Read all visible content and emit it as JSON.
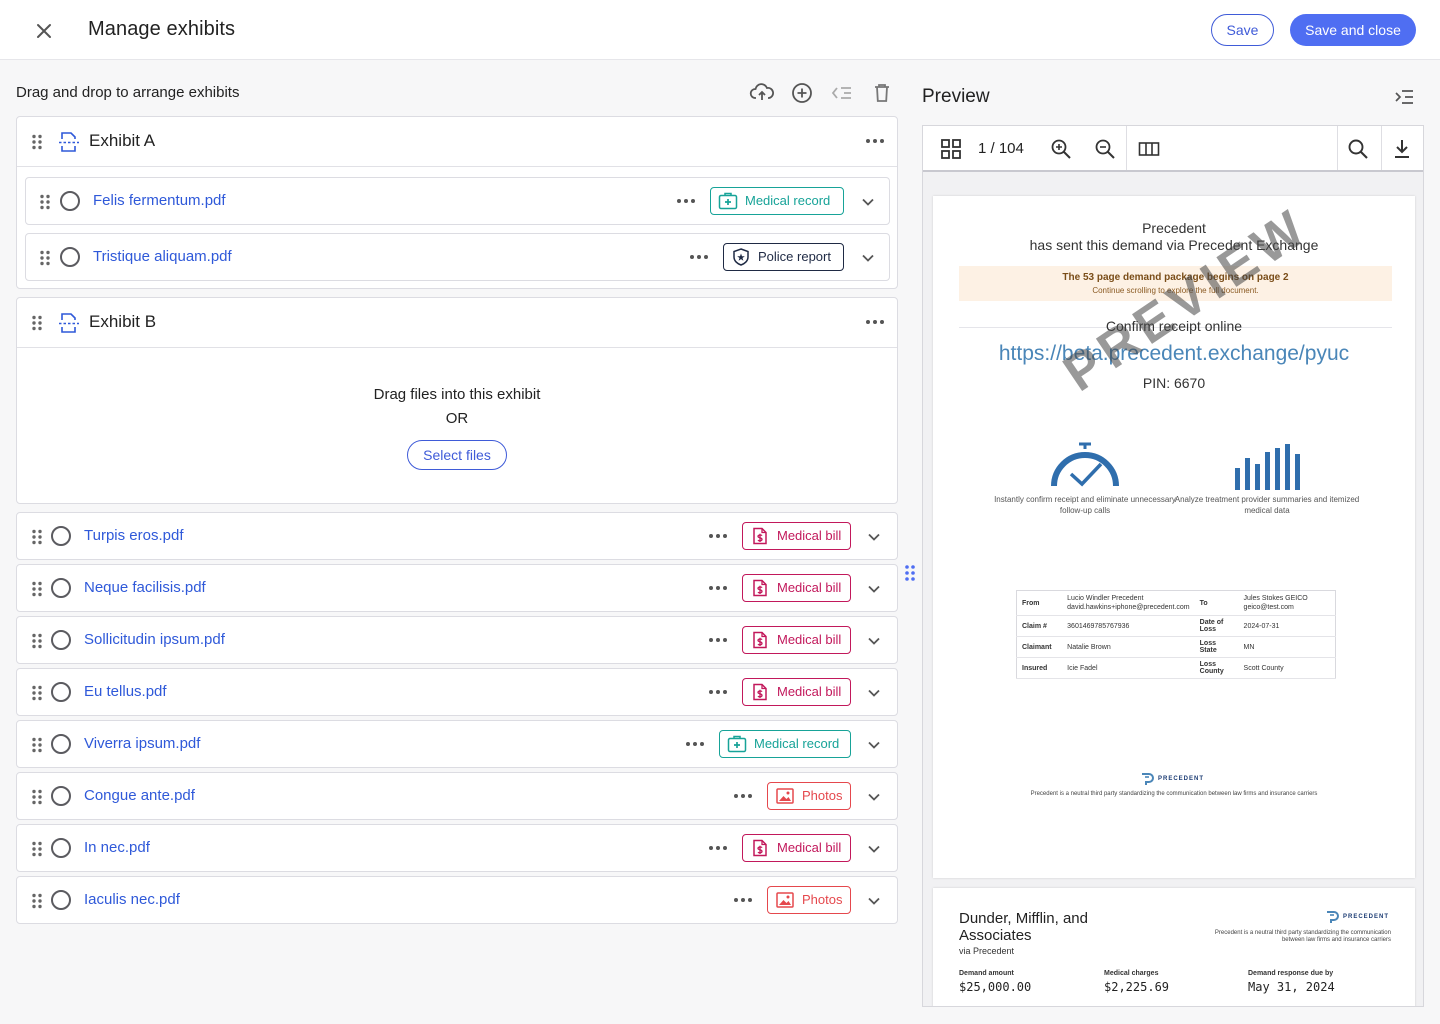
{
  "header": {
    "title": "Manage exhibits",
    "save_label": "Save",
    "save_close_label": "Save and close"
  },
  "left": {
    "heading": "Drag and drop to arrange exhibits"
  },
  "exhibit_a": {
    "title": "Exhibit A",
    "files": [
      {
        "name": "Felis fermentum.pdf",
        "tag": "Medical record"
      },
      {
        "name": "Tristique aliquam.pdf",
        "tag": "Police report"
      }
    ]
  },
  "exhibit_b": {
    "title": "Exhibit B",
    "drop_text": "Drag files into this exhibit",
    "or_text": "OR",
    "select_label": "Select files"
  },
  "files": [
    {
      "name": "Turpis eros.pdf",
      "tag": "Medical bill"
    },
    {
      "name": "Neque facilisis.pdf",
      "tag": "Medical bill"
    },
    {
      "name": "Sollicitudin ipsum.pdf",
      "tag": "Medical bill"
    },
    {
      "name": "Eu tellus.pdf",
      "tag": "Medical bill"
    },
    {
      "name": "Viverra ipsum.pdf",
      "tag": "Medical record"
    },
    {
      "name": "Congue ante.pdf",
      "tag": "Photos"
    },
    {
      "name": "In nec.pdf",
      "tag": "Medical bill"
    },
    {
      "name": "Iaculis nec.pdf",
      "tag": "Photos"
    }
  ],
  "preview": {
    "title": "Preview",
    "page_count": "1 / 104",
    "page1": {
      "sender": "Precedent",
      "sent_text": "has sent this demand via Precedent Exchange",
      "notice_title": "The 53 page demand package begins on page 2",
      "notice_sub": "Continue scrolling to explore the full document.",
      "confirm_text": "Confirm receipt online",
      "url": "https://beta.precedent.exchange/pyuc",
      "pin": "PIN: 6670",
      "watermark": "PREVIEW",
      "feature1": "Instantly confirm receipt and eliminate unnecessary follow-up calls",
      "feature2": "Analyze treatment provider summaries and itemized medical data",
      "table": {
        "from_label": "From",
        "from_value": "Lucio Windler Precedent david.hawkins+iphone@precedent.com",
        "to_label": "To",
        "to_value": "Jules Stokes GEICO geico@test.com",
        "claim_label": "Claim #",
        "claim_value": "3601469785767936",
        "dol_label": "Date of Loss",
        "dol_value": "2024-07-31",
        "claimant_label": "Claimant",
        "claimant_value": "Natalie Brown",
        "loss_state_label": "Loss State",
        "loss_state_value": "MN",
        "insured_label": "Insured",
        "insured_value": "Icie Fadel",
        "loss_county_label": "Loss County",
        "loss_county_value": "Scott County"
      },
      "logo_text": "PRECEDENT",
      "footer": "Precedent is a neutral third party standardizing the communication between law firms and insurance carriers"
    },
    "page2": {
      "firm": "Dunder, Mifflin, and Associates",
      "via": "via Precedent",
      "logo_text": "PRECEDENT",
      "tagline": "Precedent is a neutral third party standardizing the communication between law firms and insurance carriers",
      "demand_amount_label": "Demand amount",
      "demand_amount": "$25,000.00",
      "medical_charges_label": "Medical charges",
      "medical_charges": "$2,225.69",
      "due_label": "Demand response due by",
      "due_value": "May 31, 2024"
    }
  },
  "colors": {
    "accent": "#4f6ef2",
    "link": "#2f59d9",
    "record": "#17a398",
    "police": "#1f2a44",
    "bill": "#c2185b",
    "photos": "#e5484d"
  }
}
